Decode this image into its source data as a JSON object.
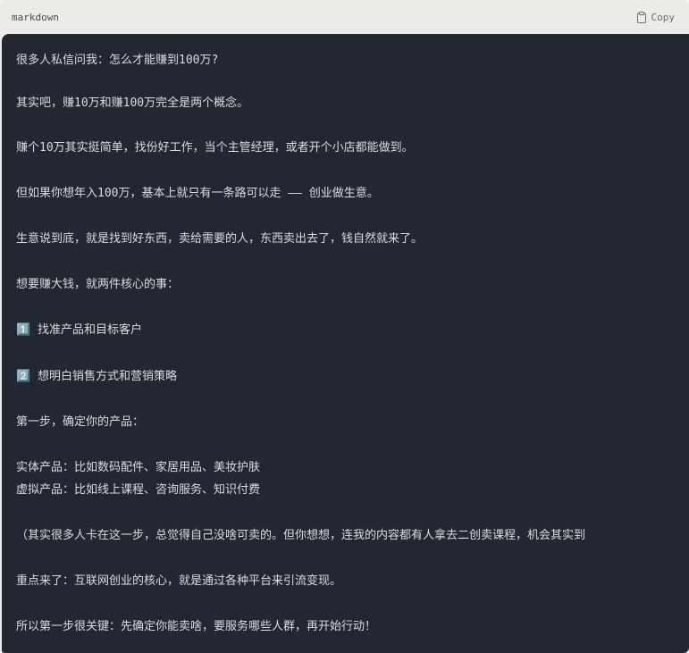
{
  "code_block": {
    "language": "markdown",
    "copy_label": "Copy",
    "copy_icon": "clipboard-icon",
    "lines": [
      "很多人私信问我：怎么才能赚到100万?",
      "其实吧，赚10万和赚100万完全是两个概念。",
      "赚个10万其实挺简单，找份好工作，当个主管经理，或者开个小店都能做到。",
      "但如果你想年入100万，基本上就只有一条路可以走 —— 创业做生意。",
      "生意说到底，就是找到好东西，卖给需要的人，东西卖出去了，钱自然就来了。",
      "想要赚大钱，就两件核心的事：",
      "1️⃣ 找准产品和目标客户",
      "2️⃣ 想明白销售方式和营销策略",
      "第一步，确定你的产品：",
      "实体产品：比如数码配件、家居用品、美妆护肤",
      "虚拟产品：比如线上课程、咨询服务、知识付费",
      "（其实很多人卡在这一步，总觉得自己没啥可卖的。但你想想，连我的内容都有人拿去二创卖课程，机会其实到",
      "重点来了：互联网创业的核心，就是通过各种平台来引流变现。",
      "所以第一步很关键：先确定你能卖啥，要服务哪些人群，再开始行动！"
    ]
  }
}
